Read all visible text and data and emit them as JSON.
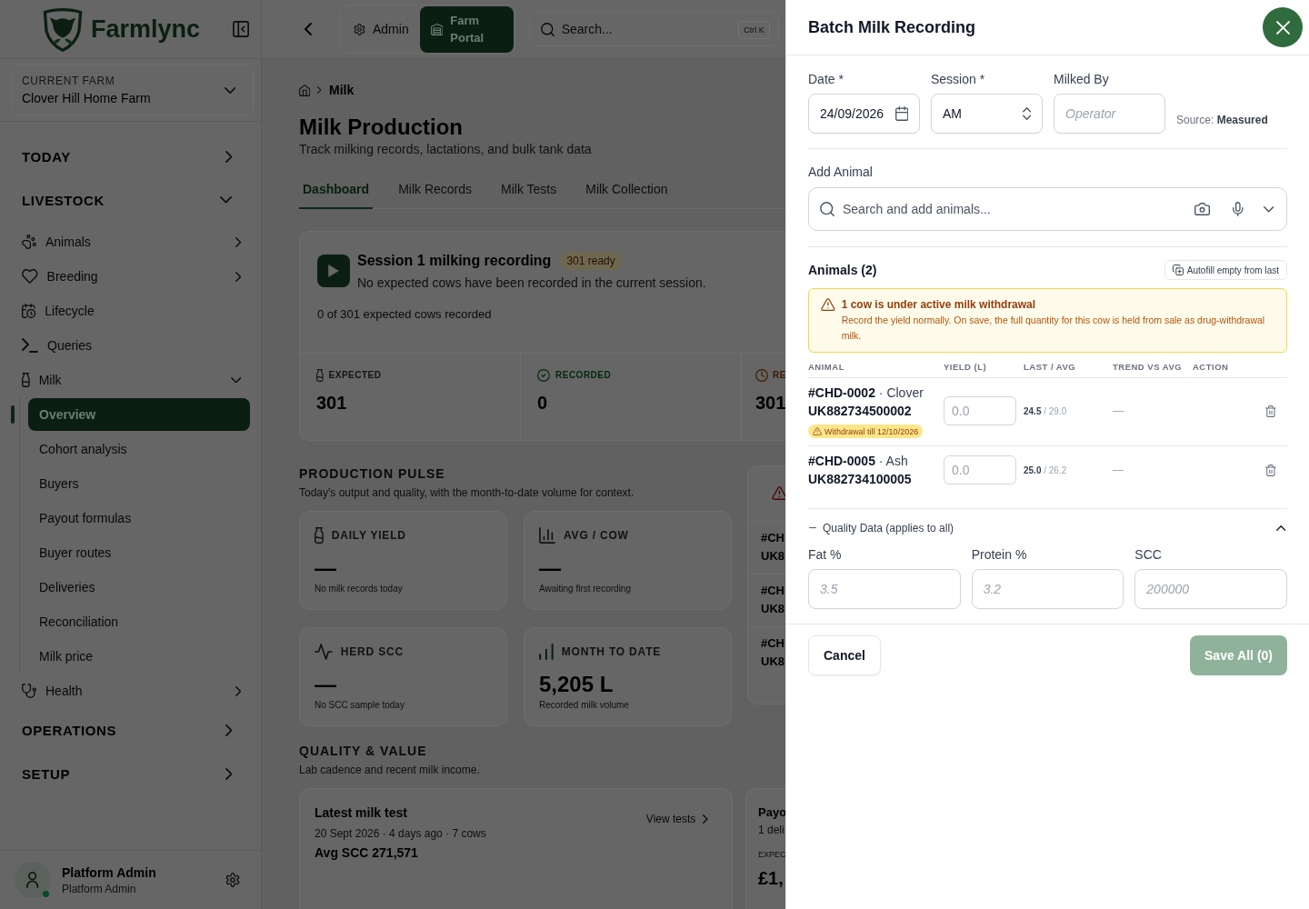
{
  "sidebar": {
    "brand": "Farmlync",
    "farm": {
      "label": "CURRENT FARM",
      "name": "Clover Hill Home Farm"
    },
    "sections": [
      {
        "label": "TODAY",
        "expanded": false
      },
      {
        "label": "LIVESTOCK",
        "expanded": true,
        "items": [
          {
            "label": "Animals",
            "expanded": false
          },
          {
            "label": "Breeding",
            "expanded": false
          },
          {
            "label": "Lifecycle"
          },
          {
            "label": "Queries"
          },
          {
            "label": "Milk",
            "expanded": true,
            "children": [
              {
                "label": "Overview",
                "selected": true
              },
              {
                "label": "Cohort analysis",
                "selected": false
              },
              {
                "label": "Buyers",
                "selected": false
              },
              {
                "label": "Payout formulas",
                "selected": false
              },
              {
                "label": "Buyer routes",
                "selected": false
              },
              {
                "label": "Deliveries",
                "selected": false
              },
              {
                "label": "Reconciliation",
                "selected": false
              },
              {
                "label": "Milk price",
                "selected": false
              }
            ]
          },
          {
            "label": "Health",
            "expanded": false
          }
        ]
      },
      {
        "label": "OPERATIONS",
        "expanded": false
      },
      {
        "label": "SETUP",
        "expanded": false
      }
    ],
    "user": {
      "name": "Platform Admin",
      "role": "Platform Admin",
      "online": true
    }
  },
  "topbar": {
    "switch": [
      {
        "label": "Admin",
        "selected": false
      },
      {
        "label": "Farm Portal",
        "selected": true
      }
    ],
    "search": {
      "placeholder": "Search...",
      "shortcut": "Ctrl K"
    }
  },
  "main": {
    "breadcrumb": [
      "Milk"
    ],
    "title": "Milk Production",
    "subtitle": "Track milking records, lactations, and bulk tank data",
    "tabs": [
      {
        "label": "Dashboard",
        "selected": true
      },
      {
        "label": "Milk Records",
        "selected": false
      },
      {
        "label": "Milk Tests",
        "selected": false
      },
      {
        "label": "Milk Collection",
        "selected": false
      }
    ],
    "session": {
      "title": "Session 1 milking recording",
      "badge": "301 ready",
      "description": "No expected cows have been recorded in the current session.",
      "progress": "0 of 301 expected cows recorded",
      "stats": [
        {
          "label": "EXPECTED",
          "value": "301",
          "color": "#141414"
        },
        {
          "label": "RECORDED",
          "value": "0",
          "color": "#022a0c"
        },
        {
          "label": "RE",
          "value": "301",
          "color": "#3d1c00"
        }
      ]
    },
    "pulse": {
      "title": "PRODUCTION PULSE",
      "subtitle": "Today's output and quality, with the month-to-date volume for context.",
      "metrics": [
        {
          "label": "DAILY YIELD",
          "value": "—",
          "note": "No milk records today"
        },
        {
          "label": "AVG / COW",
          "value": "—",
          "note": "Awaiting first recording"
        },
        {
          "label": "HERD SCC",
          "value": "—",
          "note": "No SCC sample today"
        },
        {
          "label": "MONTH TO DATE",
          "value": "5,205 L",
          "note": "Recorded milk volume"
        }
      ],
      "side_card": {
        "rows": [
          {
            "line_1": "#CH",
            "line_2": "UK8"
          },
          {
            "line_1": "#CH",
            "line_2": "UK8"
          },
          {
            "line_1": "#CH",
            "line_2": "UK8"
          }
        ]
      }
    },
    "quality_value": {
      "title": "QUALITY & VALUE",
      "subtitle": "Lab cadence and recent milk income.",
      "latest_test": {
        "title": "Latest milk test",
        "meta": "20 Sept 2026 · 4 days ago · 7 cows",
        "summary": "Avg SCC 271,571",
        "link": "View tests"
      },
      "side_card": {
        "title": "Payo",
        "line_1": "1 deli",
        "label": "EXPEC",
        "value": "£1,"
      }
    }
  },
  "panel": {
    "title": "Batch Milk Recording",
    "fields": [
      {
        "kind": "date",
        "label": "Date *",
        "value": "24/09/2026"
      },
      {
        "kind": "select",
        "label": "Session *",
        "value": "AM"
      },
      {
        "kind": "text",
        "label": "Milked By",
        "placeholder": "Operator"
      }
    ],
    "source": "Source: **Measured**",
    "add_animal": {
      "label": "Add Animal",
      "placeholder": "Search and add animals..."
    },
    "animals": {
      "title": "Animals (2)",
      "autofill": "Autofill empty from last",
      "alert": {
        "title": "1 cow is under active milk withdrawal",
        "body": "Record the yield normally. On save, the full quantity for this cow is held from sale as drug-withdrawal milk."
      },
      "columns": [
        "ANIMAL",
        "YIELD (L)",
        "LAST / AVG",
        "TREND VS AVG",
        "ACTION"
      ],
      "rows": [
        {
          "animal": "**#CHD-0002** · Clover",
          "tag": "UK882734500002",
          "withdrawal": "Withdrawal till 12/10/2026",
          "yield_placeholder": "0.0",
          "last_avg": "**24.5** / 29.0",
          "trend": "—"
        },
        {
          "animal": "**#CHD-0005** · Ash",
          "tag": "UK882734100005",
          "yield_placeholder": "0.0",
          "last_avg": "**25.0** / 26.2",
          "trend": "—"
        }
      ]
    },
    "quality": {
      "title": "Quality Data (applies to all)",
      "expanded": true,
      "fields": [
        {
          "label": "Fat %",
          "placeholder": "3.5"
        },
        {
          "label": "Protein %",
          "placeholder": "3.2"
        },
        {
          "label": "SCC",
          "placeholder": "200000"
        }
      ]
    },
    "actions": {
      "cancel": "Cancel",
      "save": {
        "label": "Save All (0)",
        "disabled": true
      }
    }
  }
}
